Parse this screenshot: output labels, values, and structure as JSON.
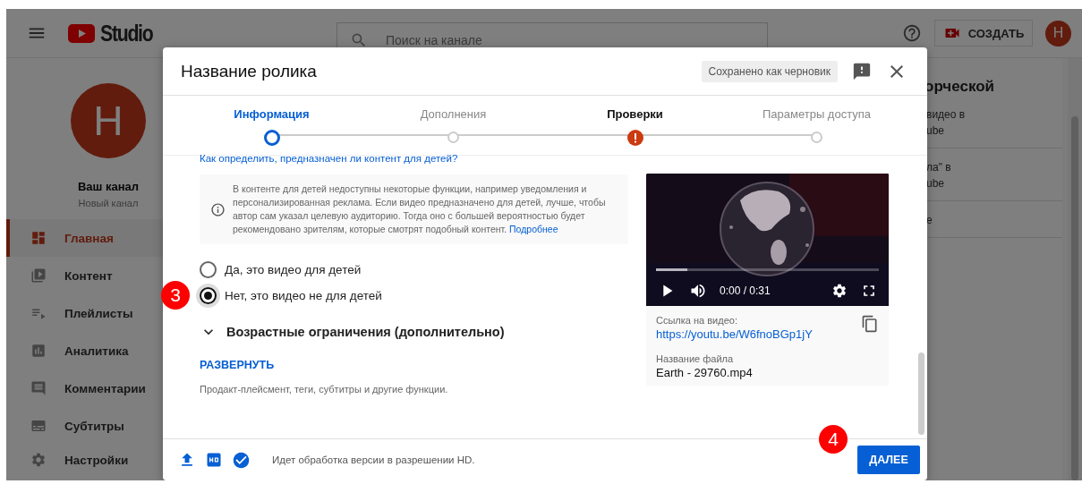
{
  "app_header": {
    "logo_text": "Studio",
    "search": {
      "placeholder": "Поиск на канале"
    },
    "create_button": "СОЗДАТЬ",
    "avatar_letter": "Н"
  },
  "sidebar": {
    "avatar_letter": "Н",
    "channel_name": "Ваш канал",
    "channel_subtitle": "Новый канал",
    "items": [
      {
        "label": "Главная",
        "kind": "dashboard",
        "selected": true
      },
      {
        "label": "Контент",
        "kind": "library",
        "selected": false
      },
      {
        "label": "Плейлисты",
        "kind": "playlist",
        "selected": false
      },
      {
        "label": "Аналитика",
        "kind": "analytics",
        "selected": false
      },
      {
        "label": "Комментарии",
        "kind": "comments",
        "selected": false
      },
      {
        "label": "Субтитры",
        "kind": "subtitles",
        "selected": false
      },
      {
        "label": "Настройки",
        "kind": "settings",
        "selected": false
      }
    ]
  },
  "right_panel": {
    "heading": "орческой",
    "cards": [
      {
        "lines": [
          "видео в",
          "ube"
        ]
      },
      {
        "lines": [
          "ла\" в",
          "ube"
        ]
      },
      {
        "lines": [
          "е"
        ]
      }
    ]
  },
  "dialog": {
    "title": "Название ролика",
    "draft_badge": "Сохранено как черновик",
    "steps": [
      {
        "label": "Информация",
        "selected": true,
        "warning": false
      },
      {
        "label": "Дополнения",
        "selected": false,
        "warning": false
      },
      {
        "label": "Проверки",
        "selected": false,
        "warning": true
      },
      {
        "label": "Параметры доступа",
        "selected": false,
        "warning": false
      }
    ],
    "help_link": "Как определить, предназначен ли контент для детей?",
    "info_text": "В контенте для детей недоступны некоторые функции, например уведомления и персонализированная реклама. Если видео предназначено для детей, лучше, чтобы автор сам указал целевую аудиторию. Тогда оно с большей вероятностью будет рекомендовано зрителям, которые смотрят подобный контент.",
    "info_link": "Подробнее",
    "audience_options": [
      {
        "label": "Да, это видео для детей",
        "selected": false
      },
      {
        "label": "Нет, это видео не для детей",
        "selected": true
      }
    ],
    "age_section": {
      "title": "Возрастные ограничения (дополнительно)",
      "expanded": false
    },
    "expand_link": "РАЗВЕРНУТЬ",
    "expand_description": "Продакт-плейсмент, теги, субтитры и другие функции.",
    "video": {
      "time": "0:00 / 0:31",
      "level": 0.14
    },
    "video_link_label": "Ссылка на видео:",
    "video_link": "https://youtu.be/W6fnoBGp1jY",
    "file_name_label": "Название файла",
    "file_name": "Earth - 29760.mp4",
    "footer_status": "Идет обработка версии в разрешении HD.",
    "next_button": "ДАЛЕЕ"
  },
  "annotations": [
    {
      "label": "3"
    },
    {
      "label": "4"
    }
  ]
}
